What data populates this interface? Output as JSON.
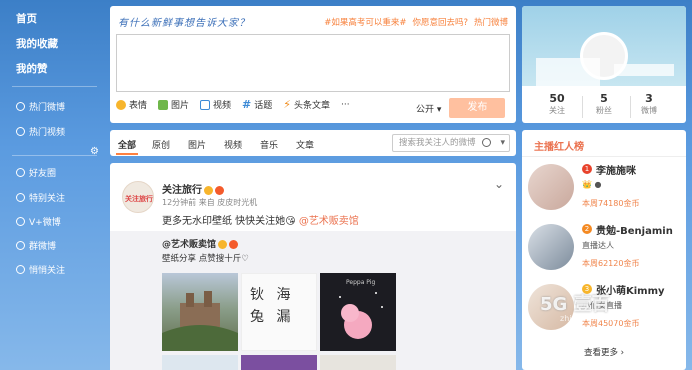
{
  "nav": {
    "home": "首页",
    "favorites": "我的收藏",
    "likes": "我的赞",
    "items": [
      "热门微博",
      "热门视频",
      "好友圈",
      "特别关注",
      "V+微博",
      "群微博",
      "悄悄关注"
    ]
  },
  "publisher": {
    "prompt": "有什么新鲜事想告诉大家？",
    "hot_links": [
      "#如果高考可以重来#",
      "你愿意回去吗?",
      "热门微博"
    ],
    "tools": [
      "表情",
      "图片",
      "视频",
      "话题",
      "头条文章",
      "···"
    ],
    "visibility": "公开",
    "post_button": "发布"
  },
  "feed": {
    "tabs": [
      "全部",
      "原创",
      "图片",
      "视频",
      "音乐",
      "文章"
    ],
    "search_placeholder": "搜索我关注人的微博"
  },
  "post": {
    "avatar_text": "关注旅行",
    "author": "关注旅行",
    "meta": "12分钟前 来自 皮皮时光机",
    "text": "更多无水印壁纸 快快关注她",
    "mention": "@艺术贩卖馆",
    "repost_author": "@艺术贩卖馆",
    "repost_text": "壁纸分享 点赞搜十斤♡",
    "image_text_art": "钬 海 兔 漏",
    "image_text_peppa": "Peppa Pig"
  },
  "profile": {
    "stats": [
      {
        "value": "50",
        "label": "关注"
      },
      {
        "value": "5",
        "label": "粉丝"
      },
      {
        "value": "3",
        "label": "微博"
      }
    ]
  },
  "streamers": {
    "title": "主播红人榜",
    "items": [
      {
        "rank": "1",
        "name": "李施施咪",
        "desc": "",
        "coins": "本周74180金币",
        "rank_color": "#e8432c"
      },
      {
        "rank": "2",
        "name": "贵勉-Benjamin",
        "desc": "直播达人",
        "coins": "本周62120金币",
        "rank_color": "#f48a23"
      },
      {
        "rank": "3",
        "name": "张小萌Kimmy",
        "desc": "小仙女直播",
        "coins": "本周45070金币",
        "rank_color": "#f7b52c"
      }
    ],
    "more": "查看更多 ›"
  },
  "watermark": {
    "logo": "5G 壹百",
    "url": "zhishiwuhao.com"
  }
}
